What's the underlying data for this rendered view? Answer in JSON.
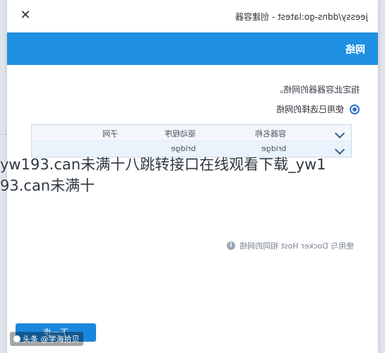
{
  "topbar": {
    "close_label": "✕",
    "path": "jeessy/ddns-go:latest - 创建容器"
  },
  "header": {
    "title": "网络"
  },
  "content": {
    "description": "指定此容器器的网络。",
    "radio_label": "使用已选择的网络",
    "table": {
      "headers": [
        "容器名称",
        "驱动程序",
        "子网"
      ],
      "rows": [
        {
          "name": "bridge",
          "driver": "bridge",
          "subnet": ""
        }
      ]
    },
    "hint": "使用与 Docker Host 相同的网络"
  },
  "footer": {
    "next_label": "下一步"
  },
  "watermark": {
    "line1": "yw193.can未满十八跳转接口在线观看下载_yw1",
    "line2": "93.can未满十"
  },
  "brand": {
    "label": "头条 @学海拾贝"
  }
}
